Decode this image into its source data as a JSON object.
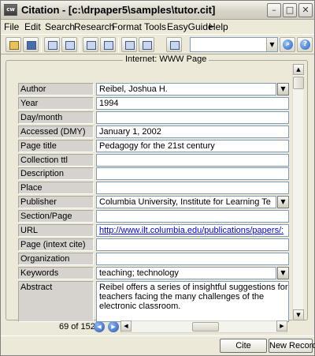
{
  "window": {
    "title": "Citation - [c:\\drpaper5\\samples\\tutor.cit]",
    "app_icon_text": "cw",
    "minimize": "–",
    "maximize": "□",
    "close": "✕"
  },
  "menu": [
    "File",
    "Edit",
    "Search",
    "Research",
    "Format",
    "Tools",
    "EasyGuide",
    "Help"
  ],
  "toolbar": {
    "search_value": "",
    "search_dropdown": "▼",
    "find_icon": "search-icon",
    "help_label": "?"
  },
  "group_title": "Internet: WWW Page",
  "fields": [
    {
      "label": "Author",
      "value": "Reibel, Joshua H.",
      "button": "▼"
    },
    {
      "label": "Year",
      "value": "1994"
    },
    {
      "label": "Day/month",
      "value": ""
    },
    {
      "label": "Accessed (DMY)",
      "value": "January 1, 2002"
    },
    {
      "label": "Page title",
      "value": "Pedagogy for the 21st century"
    },
    {
      "label": "Collection ttl",
      "value": ""
    },
    {
      "label": "Description",
      "value": ""
    },
    {
      "label": "Place",
      "value": ""
    },
    {
      "label": "Publisher",
      "value": "Columbia University, Institute for Learning Te",
      "button": "▼"
    },
    {
      "label": "Section/Page",
      "value": ""
    },
    {
      "label": "URL",
      "value": "http://www.ilt.columbia.edu/publications/papers/:",
      "link": true
    },
    {
      "label": "Page (intext cite)",
      "value": ""
    },
    {
      "label": "Organization",
      "value": ""
    },
    {
      "label": "Keywords",
      "value": "teaching; technology",
      "button": "▼"
    },
    {
      "label": "Abstract",
      "value": "Reibel offers a series of insightful suggestions for teachers facing the many challenges of the electronic classroom.",
      "abstract": true
    }
  ],
  "navigation": {
    "record_count": "69 of 152",
    "prev": "◀",
    "next": "▶",
    "scroll_left": "◀",
    "scroll_right": "▶",
    "scroll_up": "▲",
    "scroll_down": "▼"
  },
  "buttons": {
    "cite": "Cite",
    "new_record": "New Record"
  }
}
